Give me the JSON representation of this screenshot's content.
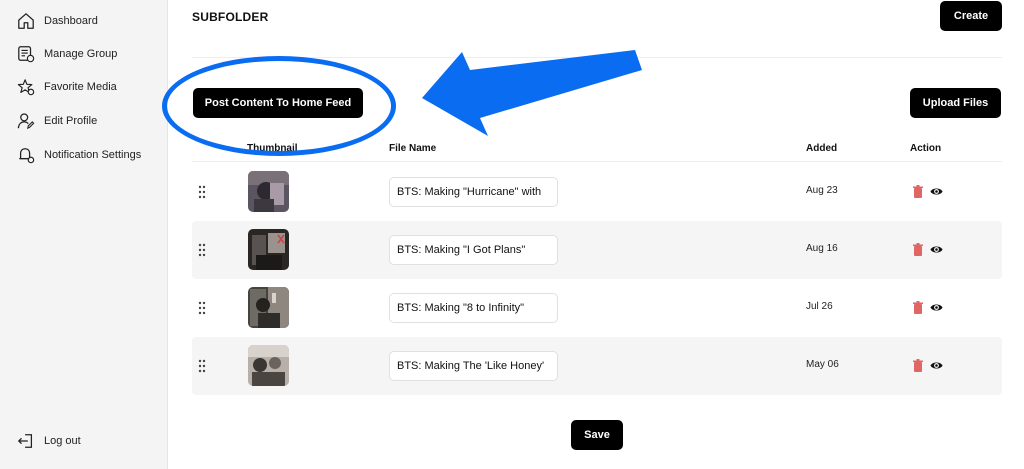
{
  "sidebar": {
    "items": [
      {
        "label": "Dashboard",
        "icon": "home-icon"
      },
      {
        "label": "Manage Group",
        "icon": "group-list-icon"
      },
      {
        "label": "Favorite Media",
        "icon": "star-gear-icon"
      },
      {
        "label": "Edit Profile",
        "icon": "user-edit-icon"
      },
      {
        "label": "Notification Settings",
        "icon": "bell-settings-icon"
      }
    ],
    "logout_label": "Log out"
  },
  "header": {
    "title": "SUBFOLDER",
    "create_label": "Create"
  },
  "toolbar": {
    "post_label": "Post Content To Home Feed",
    "upload_label": "Upload Files"
  },
  "table": {
    "columns": [
      "Thumbnail",
      "File Name",
      "Added",
      "Action"
    ],
    "rows": [
      {
        "file_name": "BTS: Making \"Hurricane\" with",
        "added": "Aug 23"
      },
      {
        "file_name": "BTS: Making \"I Got Plans\"",
        "added": "Aug 16"
      },
      {
        "file_name": "BTS: Making \"8 to Infinity\"",
        "added": "Jul 26"
      },
      {
        "file_name": "BTS: Making The 'Like Honey'",
        "added": "May 06"
      }
    ]
  },
  "footer": {
    "save_label": "Save"
  },
  "colors": {
    "button_bg": "#000000",
    "annotation_blue": "#0a6cf0",
    "delete_icon": "#e06666",
    "sidebar_bg": "#f4f4f4"
  }
}
